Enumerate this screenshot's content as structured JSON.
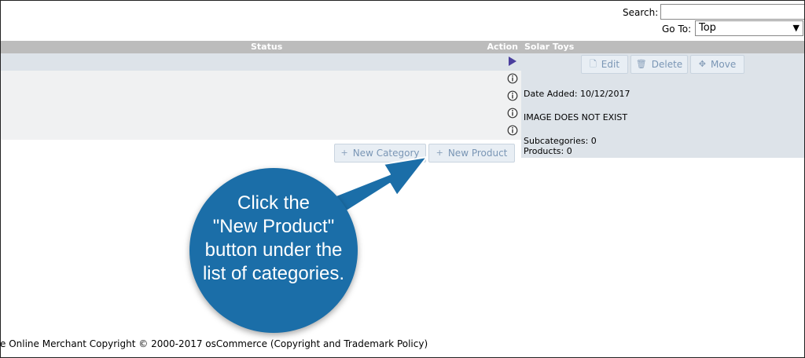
{
  "search": {
    "label": "Search:",
    "value": ""
  },
  "goto": {
    "label": "Go To:",
    "selected": "Top"
  },
  "table": {
    "columns": {
      "status": "Status",
      "action": "Action"
    }
  },
  "info": {
    "title": "Solar Toys",
    "buttons": {
      "edit": "Edit",
      "delete": "Delete",
      "move": "Move"
    },
    "date_added": "Date Added: 10/12/2017",
    "image_note": "IMAGE DOES NOT EXIST",
    "subcategories": "Subcategories: 0",
    "products": "Products: 0"
  },
  "actions": {
    "new_category": "New Category",
    "new_product": "New Product"
  },
  "callout": {
    "line1": "Click the",
    "line2": "\"New Product\"",
    "line3": "button under the",
    "line4": "list of categories."
  },
  "footer": {
    "text": "e Online Merchant Copyright © 2000-2017 osCommerce (Copyright and Trademark Policy)"
  },
  "colors": {
    "callout": "#1b6ea8",
    "header": "#bcbcbc",
    "selected_row": "#dde3e9"
  }
}
